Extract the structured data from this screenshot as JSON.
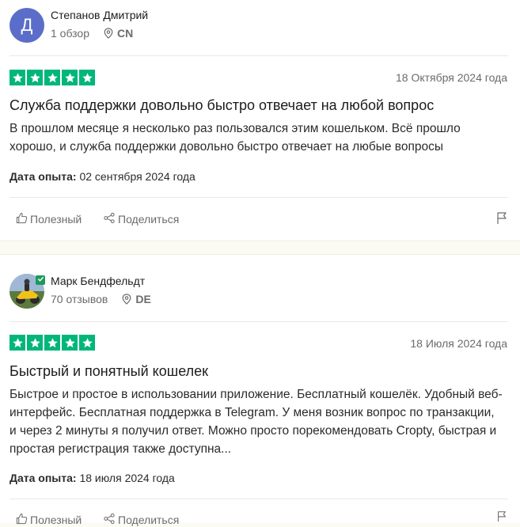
{
  "reviews": [
    {
      "avatar_letter": "Д",
      "avatar_color": "#5a6ec9",
      "author": "Степанов Дмитрий",
      "review_count": "1 обзор",
      "country": "CN",
      "rating": 5,
      "date": "18 Октября 2024 года",
      "title": "Служба поддержки довольно быстро отвечает на любой вопрос",
      "body": "В прошлом месяце я несколько раз пользовался этим кошельком. Всё прошло хорошо, и служба поддержки довольно быстро отвечает на любые вопросы",
      "experience_label": "Дата опыта:",
      "experience_date": "02 сентября 2024 года",
      "useful_label": "Полезный",
      "share_label": "Поделиться"
    },
    {
      "avatar_letter": "",
      "author": "Марк Бендфельдт",
      "review_count": "70 отзывов",
      "country": "DE",
      "rating": 5,
      "date": "18 Июля 2024 года",
      "title": "Быстрый и понятный кошелек",
      "body": "Быстрое и простое в использовании приложение. Бесплатный кошелёк. Удобный веб-интерфейс. Бесплатная поддержка в Telegram. У меня возник вопрос по транзакции, и через 2 минуты я получил ответ. Можно просто порекомендовать Cropty, быстрая и простая регистрация также доступна...",
      "experience_label": "Дата опыта:",
      "experience_date": "18 июля 2024 года",
      "useful_label": "Полезный",
      "share_label": "Поделиться"
    }
  ],
  "colors": {
    "star_green": "#00b67a",
    "verified_green": "#1b9a5a",
    "muted_text": "#6b6b6b"
  },
  "icons": {
    "star": "star-icon",
    "pin": "location-pin-icon",
    "like": "thumbs-up-icon",
    "share": "share-icon",
    "flag": "flag-icon"
  }
}
